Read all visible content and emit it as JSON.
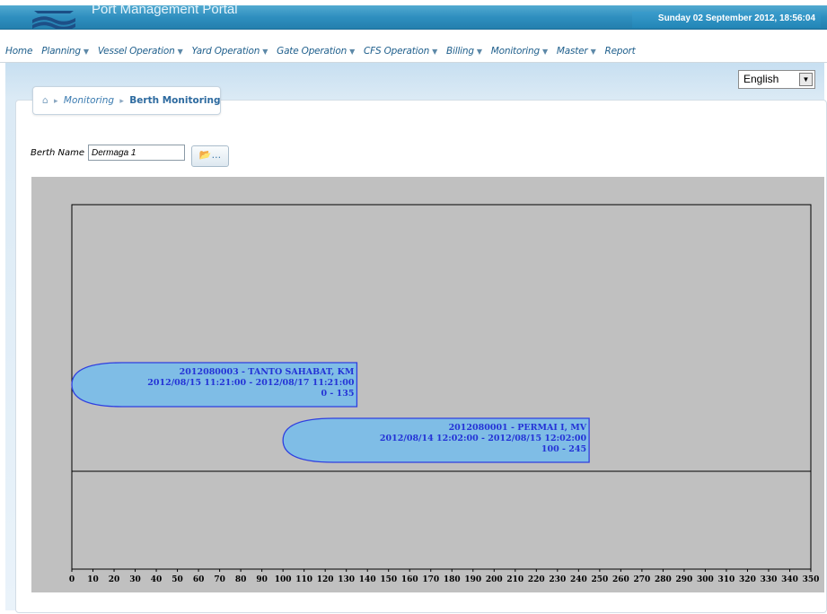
{
  "app": {
    "title": "Port Management Portal",
    "datetime": "Sunday 02 September 2012, 18:56:04"
  },
  "nav": {
    "items": [
      {
        "label": "Home",
        "dropdown": false
      },
      {
        "label": "Planning",
        "dropdown": true
      },
      {
        "label": "Vessel Operation",
        "dropdown": true
      },
      {
        "label": "Yard Operation",
        "dropdown": true
      },
      {
        "label": "Gate Operation",
        "dropdown": true
      },
      {
        "label": "CFS Operation",
        "dropdown": true
      },
      {
        "label": "Billing",
        "dropdown": true
      },
      {
        "label": "Monitoring",
        "dropdown": true
      },
      {
        "label": "Master",
        "dropdown": true
      },
      {
        "label": "Report",
        "dropdown": false
      }
    ]
  },
  "language": {
    "selected": "English"
  },
  "breadcrumb": {
    "parent": "Monitoring",
    "current": "Berth Monitoring"
  },
  "filter": {
    "label": "Berth Name",
    "value": "Dermaga 1",
    "browse_label": "..."
  },
  "chart_data": {
    "type": "bar",
    "x_ticks": [
      0,
      10,
      20,
      30,
      40,
      50,
      60,
      70,
      80,
      90,
      100,
      110,
      120,
      130,
      140,
      150,
      160,
      170,
      180,
      190,
      200,
      210,
      220,
      230,
      240,
      250,
      260,
      270,
      280,
      290,
      300,
      310,
      320,
      330,
      340,
      350
    ],
    "xlim": [
      0,
      350
    ],
    "vessels": [
      {
        "id_name": "2012080003 - TANTO SAHABAT, KM",
        "period": "2012/08/15 11:21:00 - 2012/08/17 11:21:00",
        "range": "0 - 135",
        "start": 0,
        "end": 135
      },
      {
        "id_name": "2012080001 - PERMAI I, MV",
        "period": "2012/08/14 12:02:00 - 2012/08/15 12:02:00",
        "range": "100 - 245",
        "start": 100,
        "end": 245
      }
    ],
    "colors": {
      "vessel_fill": "#7fbde6",
      "vessel_stroke": "#2f3fe0",
      "vessel_text": "#2433d6",
      "background": "#c0c0c0"
    }
  }
}
